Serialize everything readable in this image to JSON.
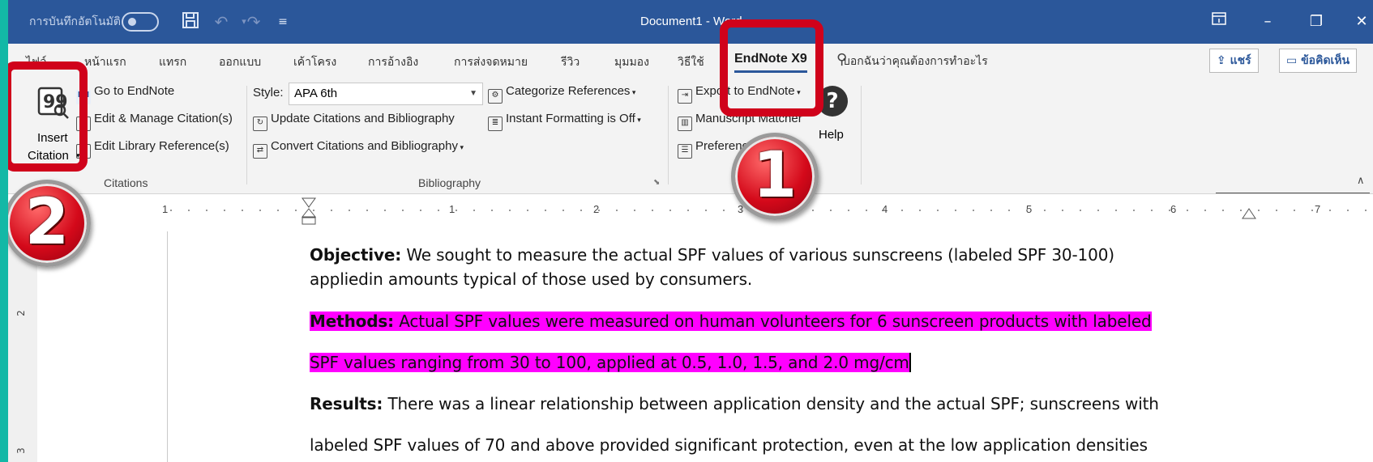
{
  "titlebar": {
    "autosave": "การบันทึกอัตโนมัติ",
    "doc_title": "Document1 - Word"
  },
  "tabs": {
    "file": "ไฟล์",
    "home": "หน้าแรก",
    "insert": "แทรก",
    "design": "ออกแบบ",
    "layout": "เค้าโครง",
    "references": "การอ้างอิง",
    "mailings": "การส่งจดหมาย",
    "review": "รีวิว",
    "view": "มุมมอง",
    "help": "วิธีใช้",
    "endnote": "EndNote X9",
    "tell_me": "บอกฉันว่าคุณต้องการทำอะไร",
    "share": "แชร์",
    "comments": "ข้อคิดเห็น"
  },
  "ribbon": {
    "citations": {
      "insert_citation_line1": "Insert",
      "insert_citation_line2": "Citation",
      "go_to_endnote": "Go to EndNote",
      "edit_manage": "Edit & Manage Citation(s)",
      "edit_library": "Edit Library Reference(s)",
      "group_label": "Citations"
    },
    "bibliography": {
      "style_label": "Style:",
      "style_value": "APA 6th",
      "categorize": "Categorize References",
      "update": "Update Citations and Bibliography",
      "instant": "Instant Formatting is Off",
      "convert": "Convert Citations and Bibliography",
      "group_label": "Bibliography"
    },
    "tools": {
      "export": "Export to EndNote",
      "manuscript": "Manuscript Matcher",
      "preferences": "Preferences",
      "help": "Help"
    }
  },
  "ruler": {
    "numbers": [
      "1",
      "1",
      "2",
      "3",
      "4",
      "5",
      "6",
      "7"
    ],
    "vertical_numbers": [
      "2",
      "3"
    ]
  },
  "document": {
    "p1_label": "Objective:",
    "p1_line1": " We sought to measure the actual SPF values of various sunscreens (labeled SPF 30-100)",
    "p1_line2": "appliedin amounts typical of those used by consumers.",
    "p2_label": "Methods:",
    "p2_line1": " Actual SPF values were measured on human volunteers for 6 sunscreen products with labeled",
    "p2_line2": "SPF values ranging from 30 to 100, applied at 0.5, 1.0, 1.5, and 2.0 mg/cm",
    "p3_label": "Results:",
    "p3_line1": " There was a linear relationship between application density and the actual SPF; sunscreens with",
    "p3_line2": "labeled SPF values of 70 and above provided significant protection, even at the low application densities"
  },
  "callouts": {
    "badge_1": "1",
    "badge_2": "2"
  },
  "colors": {
    "titlebar": "#2b579a",
    "highlight": "#ff00ff",
    "callout": "#d0021b",
    "backdrop": "#13b8a6"
  }
}
